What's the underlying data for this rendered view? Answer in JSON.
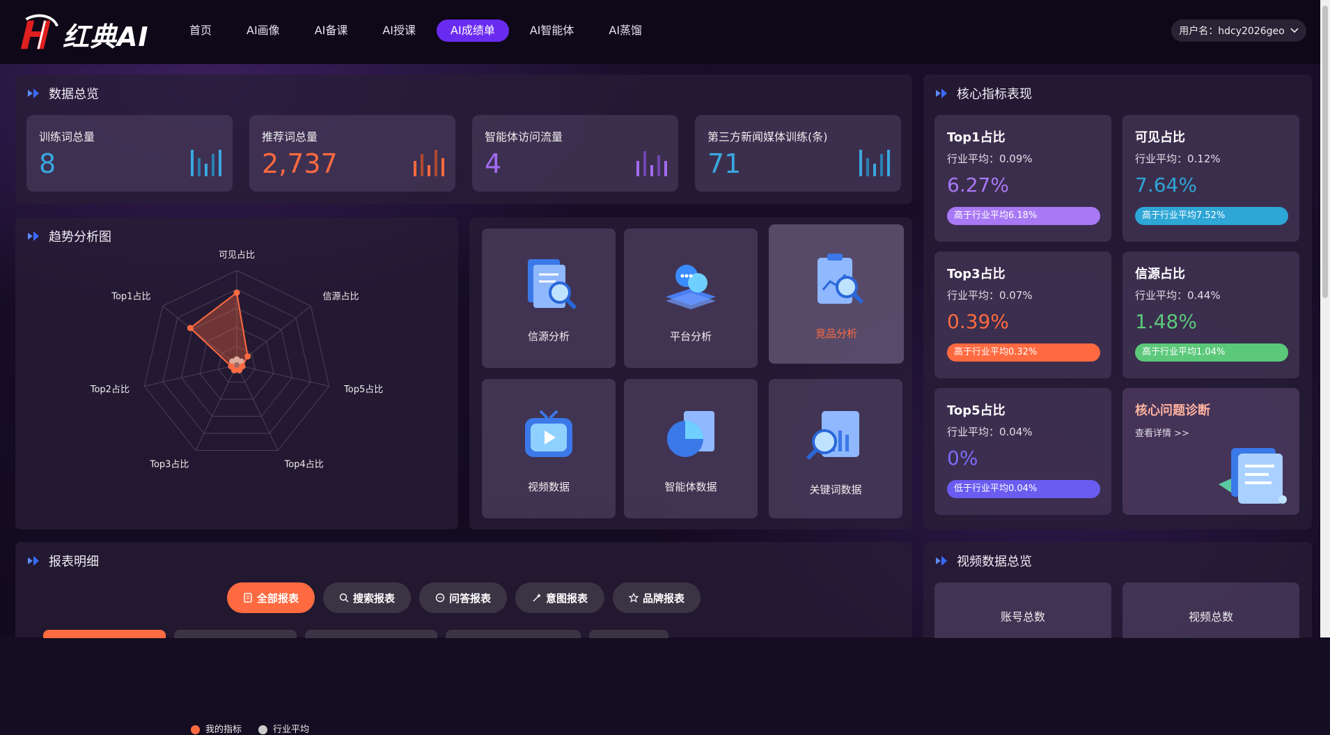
{
  "header": {
    "logo_text": "红典AI",
    "nav": [
      {
        "label": "首页"
      },
      {
        "label": "AI画像"
      },
      {
        "label": "AI备课"
      },
      {
        "label": "AI授课"
      },
      {
        "label": "AI成绩单",
        "active": true
      },
      {
        "label": "AI智能体"
      },
      {
        "label": "AI蒸馏"
      }
    ],
    "user_label": "用户名：hdcy2026geo"
  },
  "overview": {
    "title": "数据总览",
    "stats": [
      {
        "label": "训练词总量",
        "value": "8",
        "color": "#3aa8e0"
      },
      {
        "label": "推荐词总量",
        "value": "2,737",
        "color": "#ff6a40"
      },
      {
        "label": "智能体访问流量",
        "value": "4",
        "color": "#a36bf0"
      },
      {
        "label": "第三方新闻媒体训练(条)",
        "value": "71",
        "color": "#3aa8e0"
      }
    ]
  },
  "trend": {
    "title": "趋势分析图",
    "legend_mine": "我的指标",
    "legend_avg": "行业平均",
    "axes": [
      "可见占比",
      "信源占比",
      "Top5占比",
      "Top4占比",
      "Top3占比",
      "Top2占比",
      "Top1占比"
    ]
  },
  "chart_data": {
    "type": "radar",
    "axes": [
      "可见占比",
      "信源占比",
      "Top5占比",
      "Top4占比",
      "Top3占比",
      "Top2占比",
      "Top1占比"
    ],
    "series": [
      {
        "name": "我的指标",
        "values": [
          7.64,
          1.48,
          0,
          0,
          0.39,
          0,
          6.27
        ],
        "color": "#ff6a40"
      },
      {
        "name": "行业平均",
        "values": [
          0.12,
          0.44,
          0.04,
          0,
          0.07,
          0,
          0.09
        ],
        "color": "#cccccc"
      }
    ],
    "max": 10
  },
  "tiles": [
    {
      "label": "信源分析",
      "icon": "document-search-icon"
    },
    {
      "label": "平台分析",
      "icon": "chat-stack-icon"
    },
    {
      "label": "竞品分析",
      "icon": "clipboard-chart-icon",
      "highlight": true
    },
    {
      "label": "视频数据",
      "icon": "video-tv-icon"
    },
    {
      "label": "智能体数据",
      "icon": "pie-chart-icon"
    },
    {
      "label": "关键词数据",
      "icon": "search-chart-icon"
    }
  ],
  "core": {
    "title": "核心指标表现",
    "metrics": [
      {
        "title": "Top1占比",
        "avg": "行业平均：0.09%",
        "value": "6.27%",
        "pill": "高于行业平均6.18%",
        "color": "#a878f5"
      },
      {
        "title": "可见占比",
        "avg": "行业平均：0.12%",
        "value": "7.64%",
        "pill": "高于行业平均7.52%",
        "color": "#2ea6d6"
      },
      {
        "title": "Top3占比",
        "avg": "行业平均：0.07%",
        "value": "0.39%",
        "pill": "高于行业平均0.32%",
        "color": "#ff6a40"
      },
      {
        "title": "信源占比",
        "avg": "行业平均：0.44%",
        "value": "1.48%",
        "pill": "高于行业平均1.04%",
        "color": "#5cc87a"
      },
      {
        "title": "Top5占比",
        "avg": "行业平均：0.04%",
        "value": "0%",
        "pill": "低于行业平均0.04%",
        "color": "#6a5cf0"
      }
    ],
    "diagnosis_title": "核心问题诊断",
    "diagnosis_link": "查看详情 >>"
  },
  "reports": {
    "title": "报表明细",
    "tabs": [
      "全部报表",
      "搜索报表",
      "问答报表",
      "意图报表",
      "品牌报表"
    ]
  },
  "video": {
    "title": "视频数据总览",
    "cards": [
      "账号总数",
      "视频总数"
    ]
  }
}
